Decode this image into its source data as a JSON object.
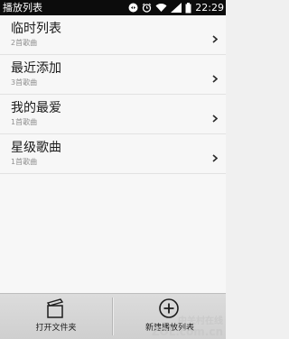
{
  "status_bar": {
    "title": "播放列表",
    "time": "22:29",
    "icons": [
      "sync-icon",
      "alarm-icon",
      "wifi-icon",
      "signal-icon",
      "battery-icon"
    ]
  },
  "playlists": [
    {
      "title": "临时列表",
      "count": "2首歌曲"
    },
    {
      "title": "最近添加",
      "count": "3首歌曲"
    },
    {
      "title": "我的最爱",
      "count": "1首歌曲"
    },
    {
      "title": "星级歌曲",
      "count": "1首歌曲"
    }
  ],
  "bottom_bar": {
    "open_folder_label": "打开文件夹",
    "new_playlist_label": "新建播放列表"
  },
  "watermark": {
    "line1": "中关村在线",
    "line2": "ZOL.com.cn"
  },
  "colors": {
    "status_bar_bg": "#0c0c0c",
    "list_bg": "#f7f7f7",
    "title_text": "#1a1a1a",
    "subtitle_text": "#8e8e8e",
    "bottom_bar_bg": "#d6d6d6"
  }
}
